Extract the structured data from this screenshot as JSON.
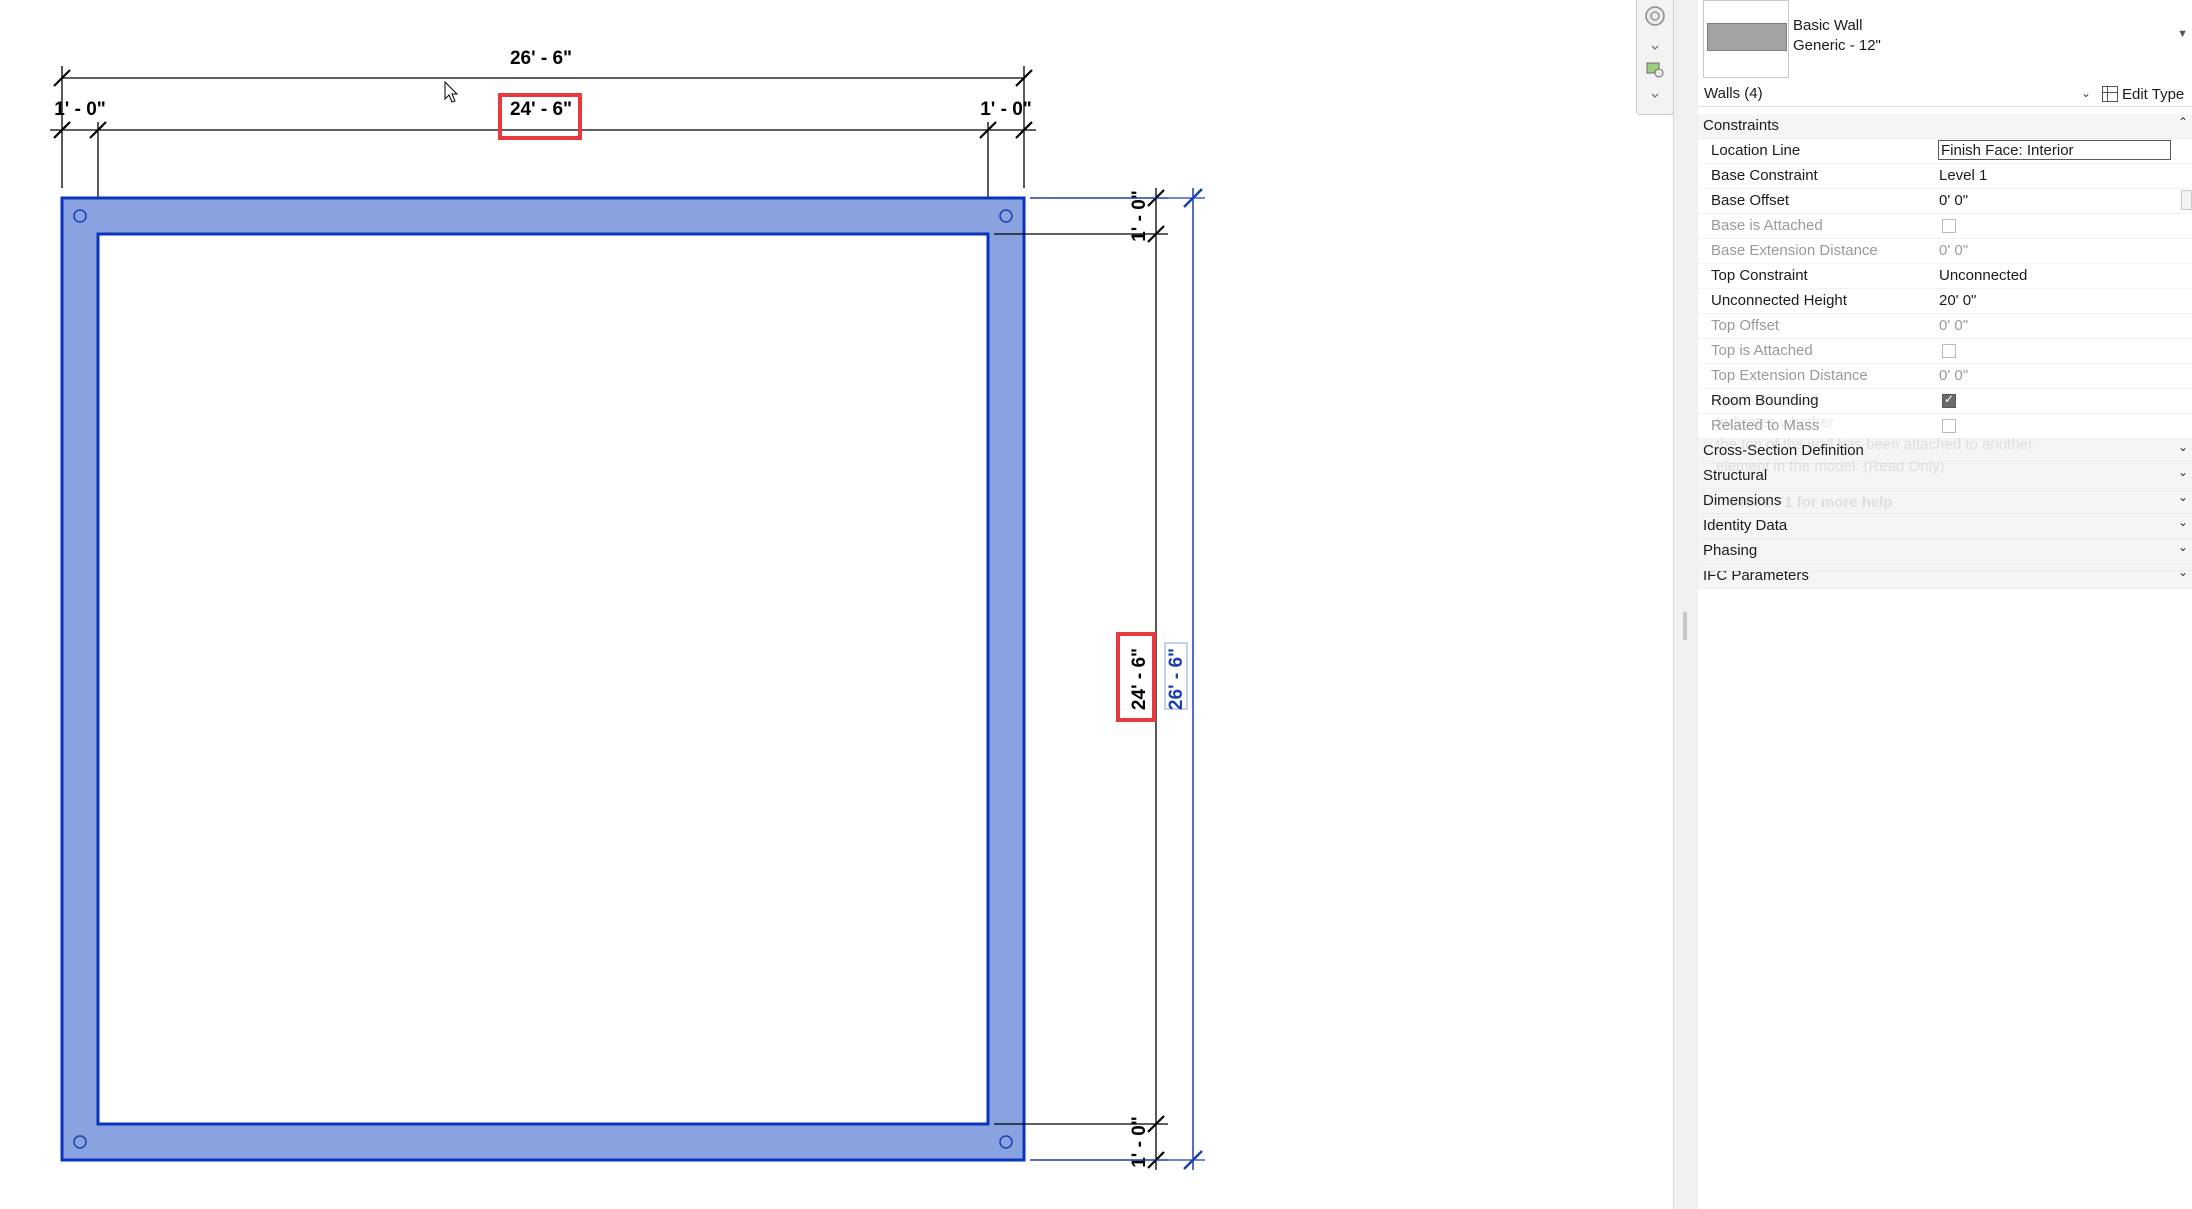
{
  "drawing": {
    "overall_width_dim": "26' - 6\"",
    "inner_width_dim": "24' - 6\"",
    "left_wall_dim": "1' - 0\"",
    "right_wall_dim": "1' - 0\"",
    "top_wall_dim": "1' - 0\"",
    "bottom_wall_dim": "1' - 0\"",
    "inner_height_dim": "24' - 6\"",
    "overall_height_dim": "26' - 6\"",
    "wall_fill_color": "#8aa3e0",
    "wall_outline_color": "#0a33c0",
    "highlight_color": "#e8393f"
  },
  "properties": {
    "type_family": "Basic Wall",
    "type_name": "Generic - 12\"",
    "selector_label": "Walls (4)",
    "edit_type_label": "Edit Type",
    "groups": {
      "constraints": "Constraints",
      "cross_section": "Cross-Section Definition",
      "structural": "Structural",
      "dimensions": "Dimensions",
      "identity": "Identity Data",
      "phasing": "Phasing",
      "ifc": "IFC Parameters"
    },
    "rows": {
      "location_line": {
        "name": "Location Line",
        "value": "Finish Face: Interior"
      },
      "base_constraint": {
        "name": "Base Constraint",
        "value": "Level 1"
      },
      "base_offset": {
        "name": "Base Offset",
        "value": "0'  0\""
      },
      "base_attached": {
        "name": "Base is Attached"
      },
      "base_ext": {
        "name": "Base Extension Distance",
        "value": "0'  0\""
      },
      "top_constraint": {
        "name": "Top Constraint",
        "value": "Unconnected"
      },
      "unconnected_height": {
        "name": "Unconnected Height",
        "value": "20'  0\""
      },
      "top_offset": {
        "name": "Top Offset",
        "value": "0'  0\""
      },
      "top_attached": {
        "name": "Top is Attached"
      },
      "top_ext": {
        "name": "Top Extension Distance",
        "value": "0'  0\""
      },
      "room_bounding": {
        "name": "Room Bounding"
      },
      "related_mass": {
        "name": "Related to Mass"
      }
    },
    "tooltip_ghost": {
      "line1": "Top is Attached",
      "line2": "Indicates whether",
      "line3": "the top of the wall has been attached to another",
      "line4": "element in the model. (Read Only)",
      "help": "Press F1 for more help"
    }
  }
}
